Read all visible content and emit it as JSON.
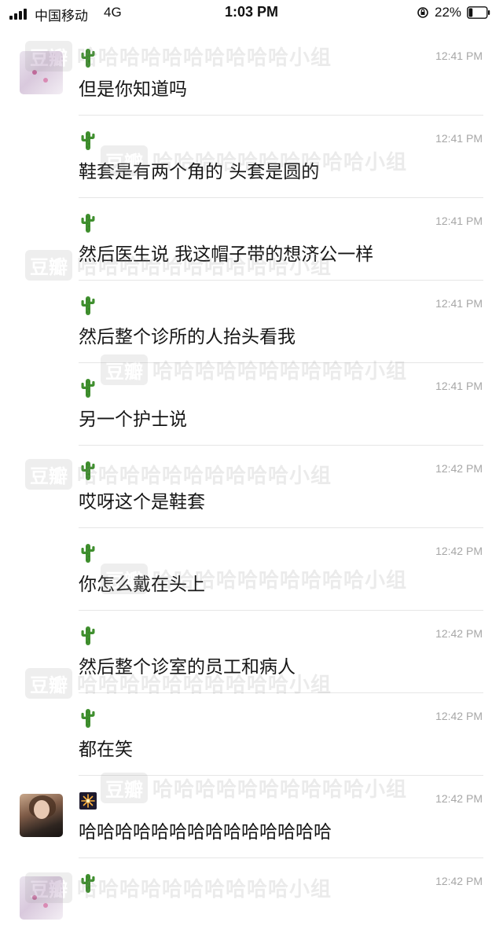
{
  "status_bar": {
    "carrier": "中国移动",
    "network": "4G",
    "time": "1:03 PM",
    "battery": "22%",
    "battery_level": 0.22,
    "icons": [
      "signal-icon",
      "orientation-lock-icon",
      "battery-icon"
    ]
  },
  "watermark": {
    "badge": "豆瓣",
    "text": "哈哈哈哈哈哈哈哈哈哈小组"
  },
  "messages": [
    {
      "time": "12:41 PM",
      "text": "但是你知道吗",
      "avatar": "avatar-1",
      "emoji": "cactus"
    },
    {
      "time": "12:41 PM",
      "text": "鞋套是有两个角的 头套是圆的",
      "emoji": "cactus"
    },
    {
      "time": "12:41 PM",
      "text": "然后医生说 我这帽子带的想济公一样",
      "emoji": "cactus"
    },
    {
      "time": "12:41 PM",
      "text": "然后整个诊所的人抬头看我",
      "emoji": "cactus"
    },
    {
      "time": "12:41 PM",
      "text": "另一个护士说",
      "emoji": "cactus"
    },
    {
      "time": "12:42 PM",
      "text": "哎呀这个是鞋套",
      "emoji": "cactus"
    },
    {
      "time": "12:42 PM",
      "text": "你怎么戴在头上",
      "emoji": "cactus"
    },
    {
      "time": "12:42 PM",
      "text": "然后整个诊室的员工和病人",
      "emoji": "cactus"
    },
    {
      "time": "12:42 PM",
      "text": "都在笑",
      "emoji": "cactus"
    },
    {
      "time": "12:42 PM",
      "text": "哈哈哈哈哈哈哈哈哈哈哈哈哈哈",
      "avatar": "avatar-2",
      "emoji": "firework"
    },
    {
      "time": "12:42 PM",
      "text": "",
      "avatar": "avatar-1",
      "emoji": "cactus"
    }
  ],
  "colors": {
    "time": "#a7a7a7",
    "text": "#161616",
    "divider": "#e6e6e6",
    "cactus": "#3f8f2e"
  }
}
